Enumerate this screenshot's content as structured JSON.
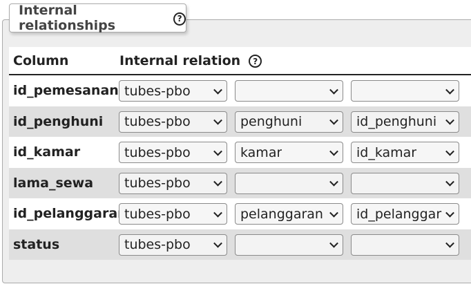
{
  "legend": {
    "title": "Internal relationships",
    "help_icon": "?"
  },
  "table": {
    "headers": {
      "column": "Column",
      "relation": "Internal relation",
      "help_icon": "?"
    },
    "rows": [
      {
        "name": "id_pemesanan",
        "database": "tubes-pbo",
        "table": "",
        "column": ""
      },
      {
        "name": "id_penghuni",
        "database": "tubes-pbo",
        "table": "penghuni",
        "column": "id_penghuni"
      },
      {
        "name": "id_kamar",
        "database": "tubes-pbo",
        "table": "kamar",
        "column": "id_kamar"
      },
      {
        "name": "lama_sewa",
        "database": "tubes-pbo",
        "table": "",
        "column": ""
      },
      {
        "name": "id_pelanggaran",
        "database": "tubes-pbo",
        "table": "pelanggaran",
        "column": "id_pelanggaran"
      },
      {
        "name": "status",
        "database": "tubes-pbo",
        "table": "",
        "column": ""
      }
    ]
  }
}
